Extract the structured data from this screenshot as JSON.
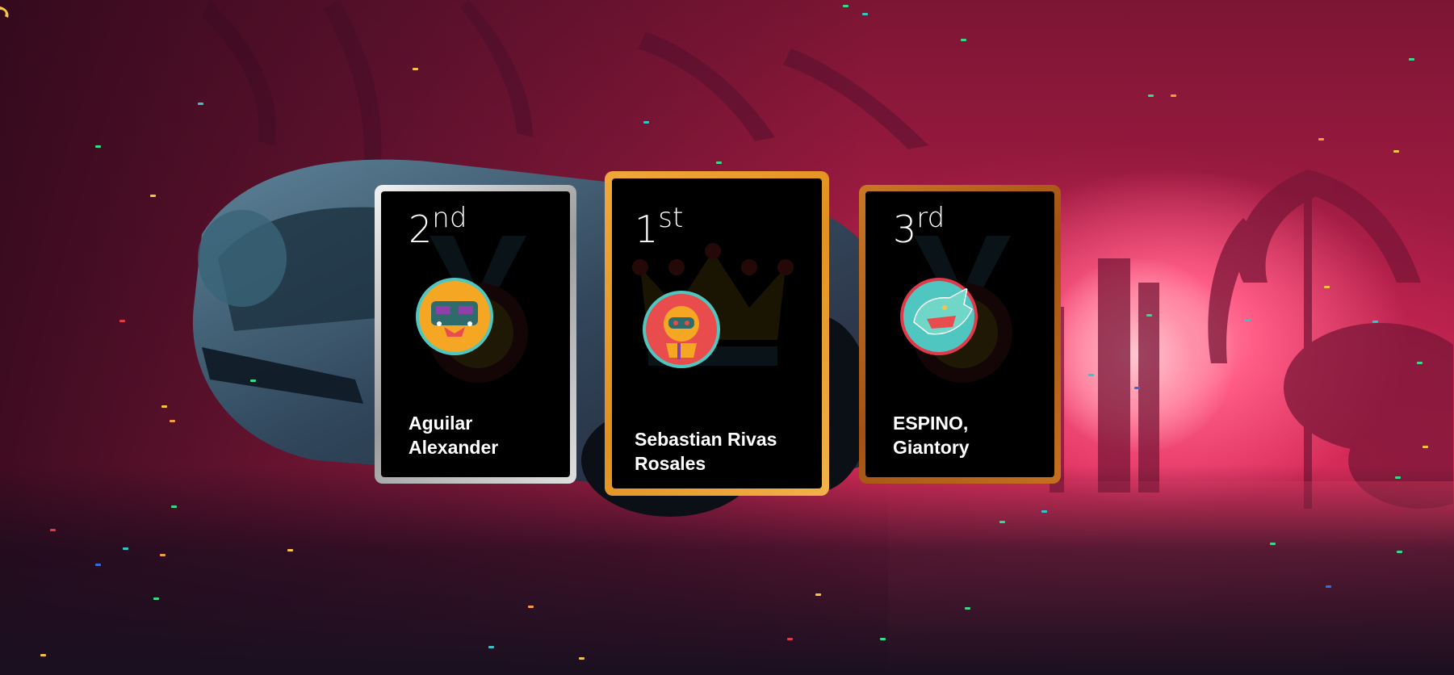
{
  "podium": {
    "second": {
      "rank_number": "2",
      "rank_suffix": "nd",
      "name": "Aguilar Alexander",
      "frame_color": "#c9c9c9",
      "avatar_bg": "#f5a623",
      "avatar_ring": "#4fc7c0"
    },
    "first": {
      "rank_number": "1",
      "rank_suffix": "st",
      "name": "Sebastian Rivas Rosales",
      "frame_color": "#e79b2b",
      "avatar_bg": "#e84c4c",
      "avatar_ring": "#4fc7c0"
    },
    "third": {
      "rank_number": "3",
      "rank_suffix": "rd",
      "name": "ESPINO, Giantory",
      "frame_color": "#b8651c",
      "avatar_bg": "#4fc7c0",
      "avatar_ring": "#e03a4a"
    }
  },
  "icons": {
    "ghost_second": "trophy-medal-icon",
    "ghost_first": "crown-icon",
    "ghost_third": "trophy-medal-icon",
    "corner": "app-logo-icon"
  },
  "colors": {
    "accent_gold": "#e79b2b",
    "accent_silver": "#c9c9c9",
    "accent_bronze": "#b8651c",
    "background_pink": "#c8244f"
  }
}
